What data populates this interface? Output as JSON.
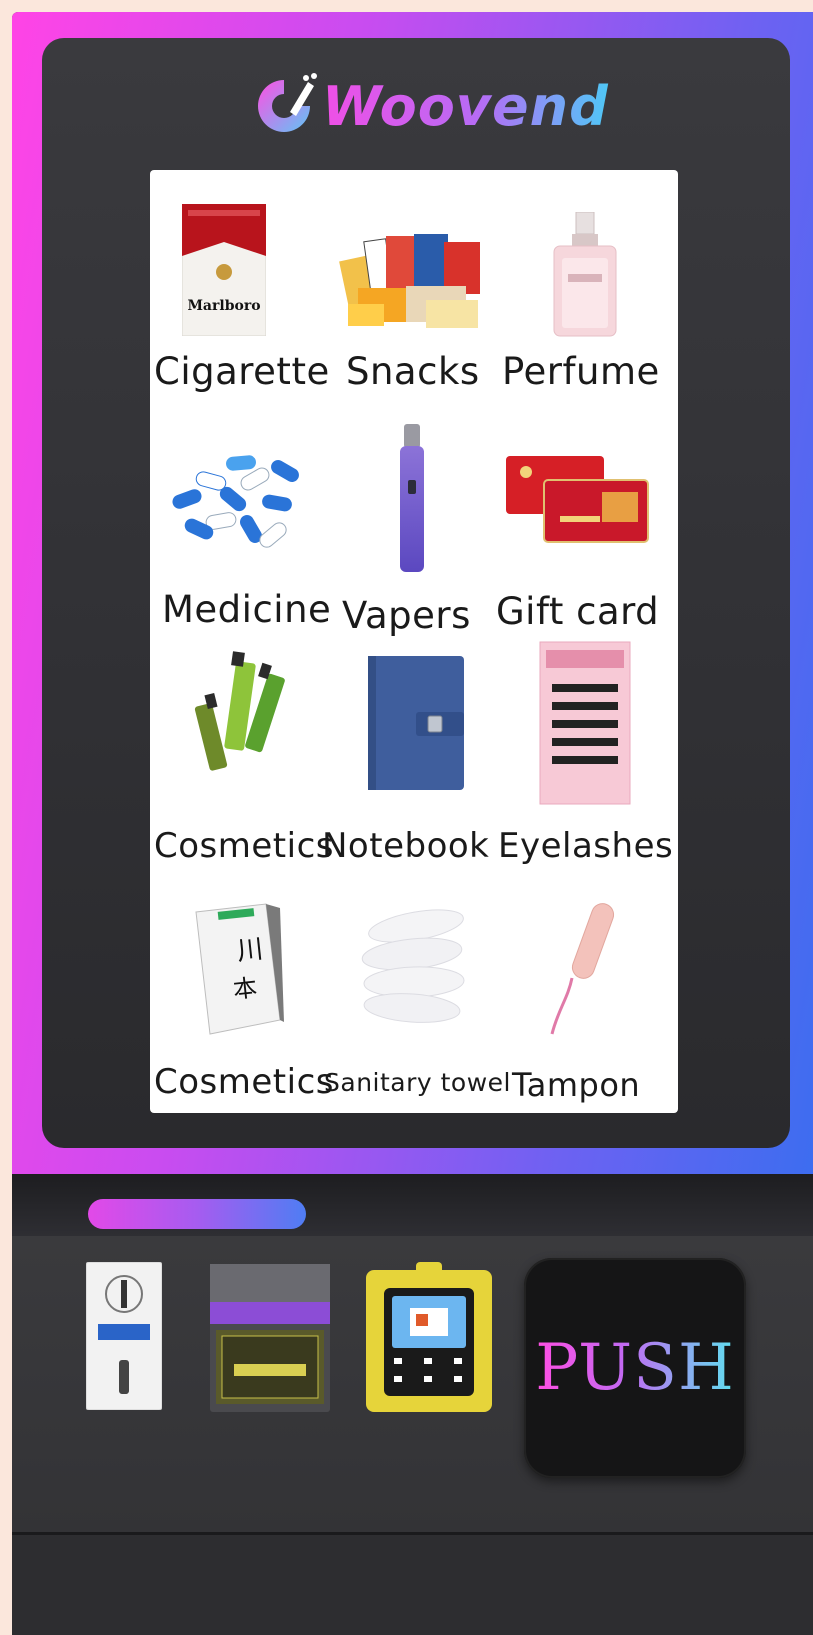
{
  "brand": {
    "name": "Woovend"
  },
  "products": [
    {
      "label": "Cigarette",
      "icon": "cigarette-pack-icon"
    },
    {
      "label": "Snacks",
      "icon": "snacks-icon"
    },
    {
      "label": "Perfume",
      "icon": "perfume-bottle-icon"
    },
    {
      "label": "Medicine",
      "icon": "capsules-icon"
    },
    {
      "label": "Vapers",
      "icon": "vape-pen-icon"
    },
    {
      "label": "Gift card",
      "icon": "gift-card-icon"
    },
    {
      "label": "Cosmetics",
      "icon": "serum-bottles-icon"
    },
    {
      "label": "Notebook",
      "icon": "notebook-icon"
    },
    {
      "label": "Eyelashes",
      "icon": "eyelashes-icon"
    },
    {
      "label": "Cosmetics",
      "icon": "product-box-icon"
    },
    {
      "label": "Sanitary towel",
      "icon": "sanitary-pads-icon"
    },
    {
      "label": "Tampon",
      "icon": "tampon-icon"
    }
  ],
  "pack_text": "Marlboro",
  "push_button": {
    "label": "PUSH"
  },
  "colors": {
    "frame_start": "#ff44e6",
    "frame_end": "#3d6df0",
    "body": "#2b2b2e",
    "screen": "#ffffff"
  }
}
